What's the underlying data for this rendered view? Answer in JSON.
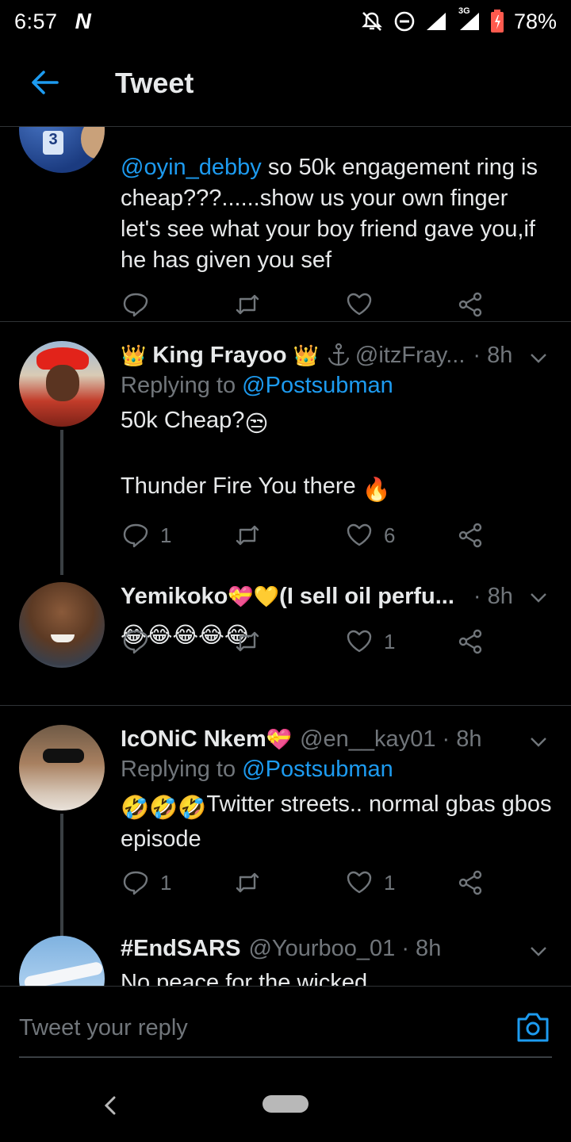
{
  "status_bar": {
    "time": "6:57",
    "carrier_icon": "N",
    "network": "3G",
    "battery": "78%",
    "icons": [
      "mute-icon",
      "do-not-disturb-icon",
      "signal-icon",
      "battery-icon"
    ]
  },
  "header": {
    "title": "Tweet",
    "back_icon": "arrow-left-icon"
  },
  "tweets": [
    {
      "mention": "@oyin_debby",
      "text": " so 50k engagement ring is cheap???......show us your own finger let's see what your boy friend gave you,if he has given you sef",
      "replies": "",
      "retweets": "",
      "likes": ""
    },
    {
      "name": "King Frayoo",
      "handle": "@itzFray...",
      "time": "· 8h",
      "replying_label": "Replying to ",
      "replying_to": "@Postsubman",
      "line1": "50k Cheap?",
      "line2": "Thunder Fire You there ",
      "replies": "1",
      "retweets": "",
      "likes": "6"
    },
    {
      "name": "Yemikoko",
      "name_suffix": "(I sell oil perfu...",
      "time": "· 8h",
      "text": "",
      "replies": "",
      "retweets": "",
      "likes": "1"
    },
    {
      "name": "IcONiC Nkem",
      "handle": "@en__kay01 · 8h",
      "replying_label": "Replying to ",
      "replying_to": "@Postsubman",
      "text": "Twitter streets.. normal gbas gbos episode",
      "replies": "1",
      "retweets": "",
      "likes": "1"
    },
    {
      "name": "#EndSARS",
      "handle": "@Yourboo_01 · 8h",
      "text": "No peace for the wicked"
    }
  ],
  "reply_bar": {
    "placeholder": "Tweet your reply"
  },
  "colors": {
    "background": "#000000",
    "accent": "#1d9bf0",
    "secondary_text": "#71767b",
    "divider": "#2f3336"
  }
}
